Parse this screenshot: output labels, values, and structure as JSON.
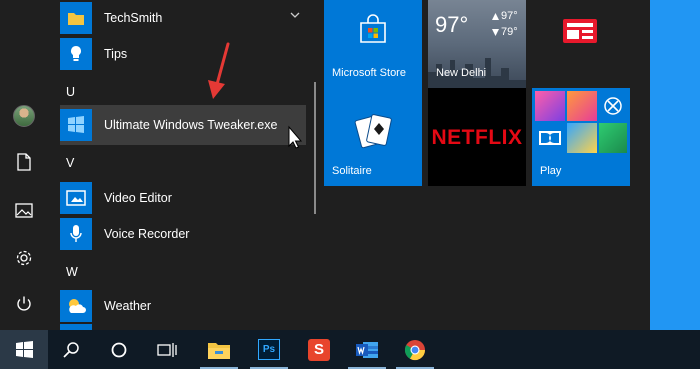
{
  "colors": {
    "tile_blue": "#0078d7",
    "start_bg": "#1f1f1f",
    "taskbar_bg": "#0f1a25",
    "annotation_red": "#e53935"
  },
  "rail": [
    "user-avatar",
    "document-icon",
    "pictures-icon",
    "settings-gear-icon",
    "power-icon"
  ],
  "apps": {
    "techsmith": "TechSmith",
    "tips": "Tips",
    "letter_u": "U",
    "uwt": "Ultimate Windows Tweaker.exe",
    "letter_v": "V",
    "video_editor": "Video Editor",
    "voice_recorder": "Voice Recorder",
    "letter_w": "W",
    "weather": "Weather"
  },
  "tiles": {
    "store": "Microsoft Store",
    "weather_temp": "97°",
    "weather_high": "97°",
    "weather_low": "79°",
    "weather_city": "New Delhi",
    "solitaire": "Solitaire",
    "netflix": "NETFLIX",
    "play": "Play"
  },
  "taskbar": [
    "windows-start-icon",
    "search-icon",
    "cortana-icon",
    "task-view-icon",
    "file-explorer-icon",
    "photoshop-icon",
    "snagit-icon",
    "word-icon",
    "chrome-icon"
  ]
}
